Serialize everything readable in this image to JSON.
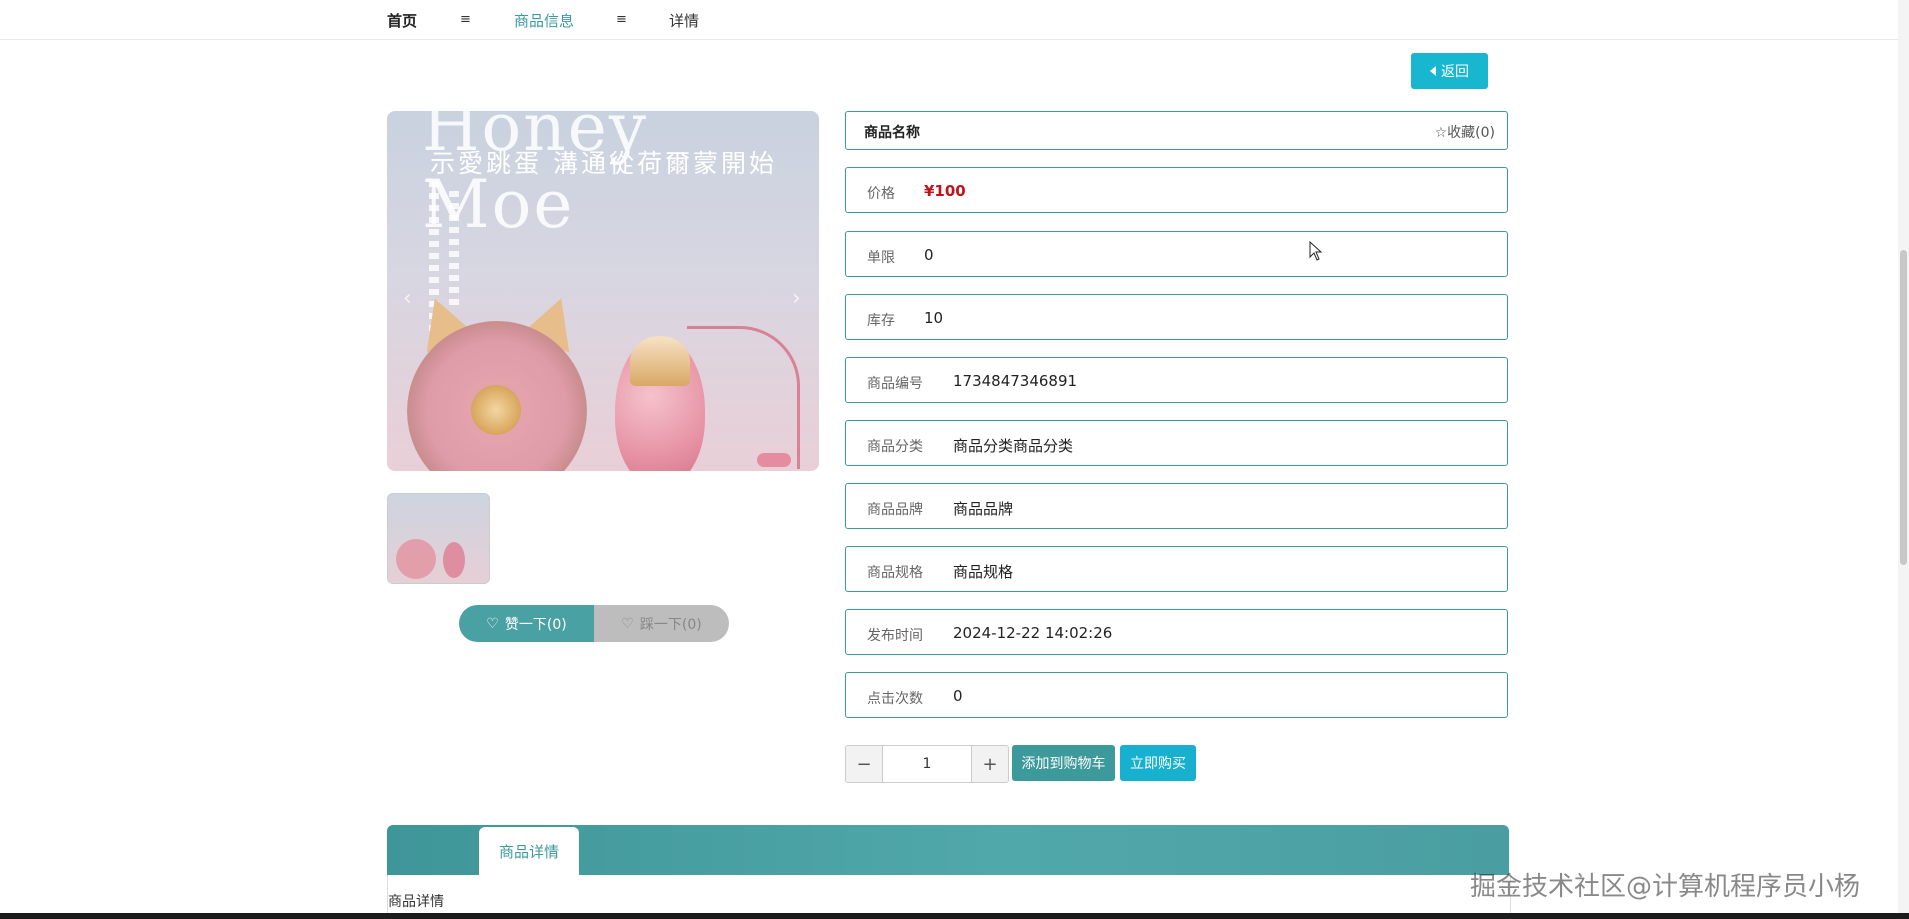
{
  "breadcrumb": {
    "home": "首页",
    "sep": "≡",
    "mid": "商品信息",
    "last": "详情"
  },
  "back_button": "返回",
  "image_text": {
    "title": "Honey Moe",
    "slogan": "示愛跳蛋 溝通從荷爾蒙開始"
  },
  "votes": {
    "up": "赞一下(0)",
    "down": "踩一下(0)"
  },
  "product": {
    "name_label": "商品名称",
    "favorite": "☆收藏(0)",
    "fields": [
      {
        "label": "价格",
        "value": "¥100"
      },
      {
        "label": "单限",
        "value": "0"
      },
      {
        "label": "库存",
        "value": "10"
      },
      {
        "label": "商品编号",
        "value": "1734847346891"
      },
      {
        "label": "商品分类",
        "value": "商品分类商品分类"
      },
      {
        "label": "商品品牌",
        "value": "商品品牌"
      },
      {
        "label": "商品规格",
        "value": "商品规格"
      },
      {
        "label": "发布时间",
        "value": "2024-12-22 14:02:26"
      },
      {
        "label": "点击次数",
        "value": "0"
      }
    ]
  },
  "quantity": {
    "minus": "−",
    "value": "1",
    "plus": "+"
  },
  "actions": {
    "add_to_cart": "添加到购物车",
    "buy_now": "立即购买"
  },
  "tabs": {
    "active": "商品详情"
  },
  "detail_text": "商品详情",
  "watermark": "掘金技术社区@计算机程序员小杨",
  "colors": {
    "accent": "#3d9a9c",
    "cyan": "#19b6cf",
    "price": "#c0141b"
  }
}
